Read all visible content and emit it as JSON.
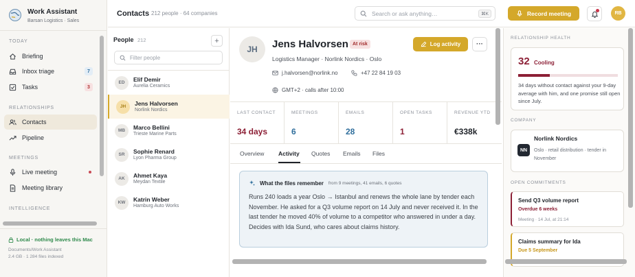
{
  "app": {
    "title": "Work Assistant",
    "subtitle": "Barsan Logistics · Sales"
  },
  "sidebar": {
    "sections": [
      {
        "label": "TODAY"
      },
      {
        "label": "RELATIONSHIPS"
      },
      {
        "label": "MEETINGS"
      },
      {
        "label": "INTELLIGENCE"
      }
    ],
    "items": [
      {
        "label": "Briefing",
        "icon": "home-icon"
      },
      {
        "label": "Inbox triage",
        "icon": "inbox-icon",
        "badge": "7"
      },
      {
        "label": "Tasks",
        "icon": "checkbox-icon",
        "badge": "3"
      },
      {
        "label": "Contacts",
        "icon": "people-icon"
      },
      {
        "label": "Pipeline",
        "icon": "trend-icon"
      },
      {
        "label": "Live meeting",
        "icon": "microphone-icon"
      },
      {
        "label": "Meeting library",
        "icon": "document-icon"
      }
    ],
    "footer": {
      "local": "Local · nothing leaves this Mac",
      "path": "Documents/Work Assistant",
      "stats": "2.4 GB · 1 284 files indexed"
    }
  },
  "topbar": {
    "title": "Contacts",
    "meta": "212 people · 64 companies",
    "search_placeholder": "Search or ask anything…",
    "shortcut": "⌘K",
    "record_label": "Record meeting",
    "avatar_initials": "RB"
  },
  "people": {
    "heading": "People",
    "count": "212",
    "add_label": "+",
    "filter_placeholder": "Filter people",
    "list": [
      {
        "initials": "ED",
        "name": "Elif Demir",
        "company": "Aurelia Ceramics"
      },
      {
        "initials": "JH",
        "name": "Jens Halvorsen",
        "company": "Norlink Nordics"
      },
      {
        "initials": "MB",
        "name": "Marco Bellini",
        "company": "Trieste Marine Parts"
      },
      {
        "initials": "SR",
        "name": "Sophie Renard",
        "company": "Lyon Pharma Group"
      },
      {
        "initials": "AK",
        "name": "Ahmet Kaya",
        "company": "Meydan Textile"
      },
      {
        "initials": "KW",
        "name": "Katrin Weber",
        "company": "Hamburg Auto Works"
      }
    ]
  },
  "contact": {
    "initials": "JH",
    "name": "Jens Halvorsen",
    "status": "At risk",
    "role": "Logistics Manager · Norlink Nordics · Oslo",
    "email": "j.halvorsen@norlink.no",
    "phone": "+47 22 84 19 03",
    "timezone": "GMT+2 · calls after 10:00",
    "log_label": "Log activity",
    "more_label": "···",
    "stats": [
      {
        "label": "LAST CONTACT",
        "value": "34 days",
        "color": "#8c1f35"
      },
      {
        "label": "MEETINGS",
        "value": "6",
        "color": "#2f6e9c"
      },
      {
        "label": "EMAILS",
        "value": "28",
        "color": "#2f6e9c"
      },
      {
        "label": "OPEN TASKS",
        "value": "1",
        "color": "#8c1f35"
      },
      {
        "label": "REVENUE YTD",
        "value": "€338k",
        "color": "#1f2329"
      }
    ],
    "tabs": [
      "Overview",
      "Activity",
      "Quotes",
      "Emails",
      "Files"
    ],
    "memo": {
      "title": "What the files remember",
      "source": "from 9 meetings, 41 emails, 6 quotes",
      "body": "Runs 240 loads a year Oslo → Istanbul and renews the whole lane by tender each November. He asked for a Q3 volume report on 14 July and never received it. In the last tender he moved 40% of volume to a competitor who answered in under a day. Decides with Ida Sund, who cares about claims history."
    }
  },
  "right": {
    "health": {
      "section": "RELATIONSHIP HEALTH",
      "score": "32",
      "label": "Cooling",
      "level": 0.32,
      "text": "34 days without contact against your 9-day average with him, and one promise still open since July."
    },
    "company": {
      "section": "COMPANY",
      "logo": "NN",
      "name": "Norlink Nordics",
      "desc": "Oslo · retail distribution · tender in November"
    },
    "commitments": {
      "section": "OPEN COMMITMENTS",
      "items": [
        {
          "title": "Send Q3 volume report",
          "due": "Overdue 6 weeks",
          "meta": "Meeting · 14 Jul, at 21:14"
        },
        {
          "title": "Claims summary for Ida",
          "due": "Due 5 September"
        }
      ]
    }
  },
  "colors": {
    "accent": "#d4a82a",
    "risk": "#8c1f35",
    "blue": "#2f6e9c",
    "success": "#2f8a4c"
  }
}
